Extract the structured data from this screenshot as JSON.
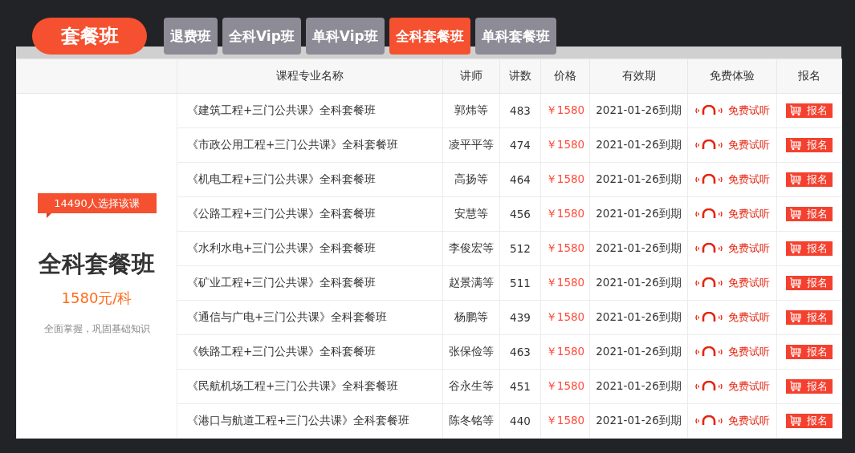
{
  "brand": "套餐班",
  "tabs": [
    {
      "label": "退费班",
      "selected": false
    },
    {
      "label": "全科Vip班",
      "selected": false
    },
    {
      "label": "单科Vip班",
      "selected": false
    },
    {
      "label": "全科套餐班",
      "selected": true
    },
    {
      "label": "单科套餐班",
      "selected": false
    }
  ],
  "package": {
    "badge": "14490人选择该课",
    "title": "全科套餐班",
    "price": "1580元/科",
    "slogan": "全面掌握，巩固基础知识"
  },
  "table": {
    "columns": [
      "课程专业名称",
      "讲师",
      "讲数",
      "价格",
      "有效期",
      "免费体验",
      "报名"
    ],
    "rows": [
      {
        "name": "《建筑工程+三门公共课》全科套餐班",
        "teacher": "郭炜等",
        "lessons": "483",
        "price": "￥1580",
        "expiry": "2021-01-26到期",
        "trial": "免费试听",
        "signup": "报名"
      },
      {
        "name": "《市政公用工程+三门公共课》全科套餐班",
        "teacher": "凌平平等",
        "lessons": "474",
        "price": "￥1580",
        "expiry": "2021-01-26到期",
        "trial": "免费试听",
        "signup": "报名"
      },
      {
        "name": "《机电工程+三门公共课》全科套餐班",
        "teacher": "高扬等",
        "lessons": "464",
        "price": "￥1580",
        "expiry": "2021-01-26到期",
        "trial": "免费试听",
        "signup": "报名"
      },
      {
        "name": "《公路工程+三门公共课》全科套餐班",
        "teacher": "安慧等",
        "lessons": "456",
        "price": "￥1580",
        "expiry": "2021-01-26到期",
        "trial": "免费试听",
        "signup": "报名"
      },
      {
        "name": "《水利水电+三门公共课》全科套餐班",
        "teacher": "李俊宏等",
        "lessons": "512",
        "price": "￥1580",
        "expiry": "2021-01-26到期",
        "trial": "免费试听",
        "signup": "报名"
      },
      {
        "name": "《矿业工程+三门公共课》全科套餐班",
        "teacher": "赵景满等",
        "lessons": "511",
        "price": "￥1580",
        "expiry": "2021-01-26到期",
        "trial": "免费试听",
        "signup": "报名"
      },
      {
        "name": "《通信与广电+三门公共课》全科套餐班",
        "teacher": "杨鹏等",
        "lessons": "439",
        "price": "￥1580",
        "expiry": "2021-01-26到期",
        "trial": "免费试听",
        "signup": "报名"
      },
      {
        "name": "《铁路工程+三门公共课》全科套餐班",
        "teacher": "张保俭等",
        "lessons": "463",
        "price": "￥1580",
        "expiry": "2021-01-26到期",
        "trial": "免费试听",
        "signup": "报名"
      },
      {
        "name": "《民航机场工程+三门公共课》全科套餐班",
        "teacher": "谷永生等",
        "lessons": "451",
        "price": "￥1580",
        "expiry": "2021-01-26到期",
        "trial": "免费试听",
        "signup": "报名"
      },
      {
        "name": "《港口与航道工程+三门公共课》全科套餐班",
        "teacher": "陈冬铭等",
        "lessons": "440",
        "price": "￥1580",
        "expiry": "2021-01-26到期",
        "trial": "免费试听",
        "signup": "报名"
      }
    ]
  }
}
